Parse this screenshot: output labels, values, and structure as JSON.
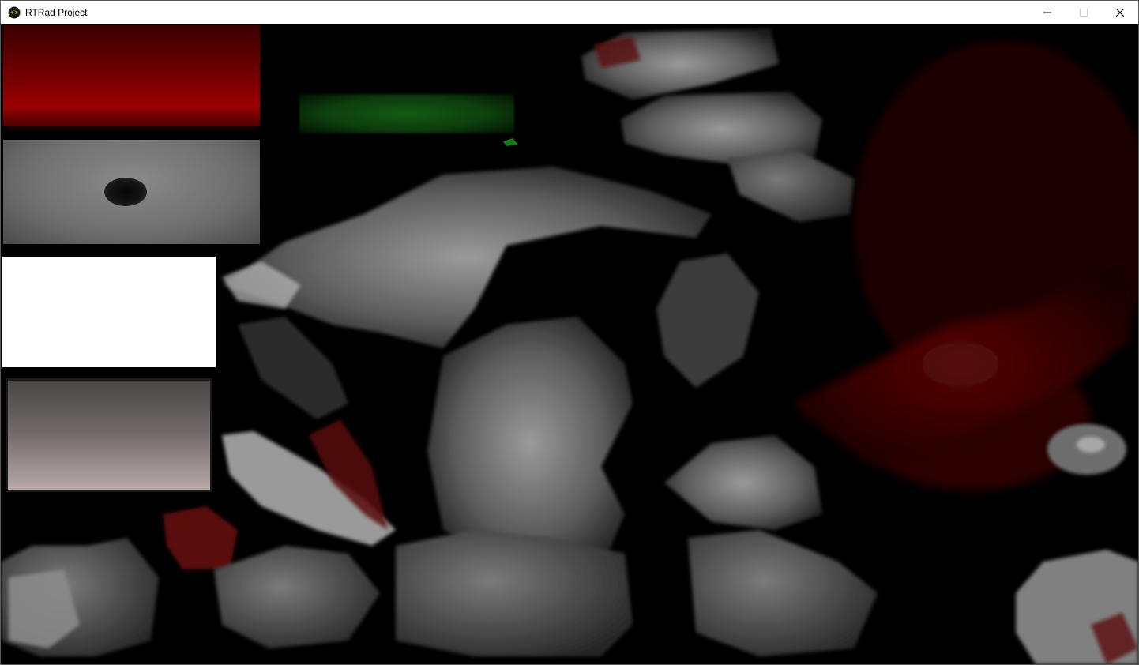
{
  "window": {
    "title": "RTRad Project",
    "icon": "nvidia-eye-icon"
  },
  "caption_buttons": [
    {
      "name": "minimize",
      "icon": "minimize-icon"
    },
    {
      "name": "maximize",
      "icon": "maximize-icon",
      "disabled": true
    },
    {
      "name": "close",
      "icon": "close-icon"
    }
  ],
  "viewport": {
    "description_colors": {
      "background": "#000000",
      "accent_red": "#8a0000",
      "accent_green": "#145a14",
      "surface_gray": "#8a8a8a"
    }
  }
}
